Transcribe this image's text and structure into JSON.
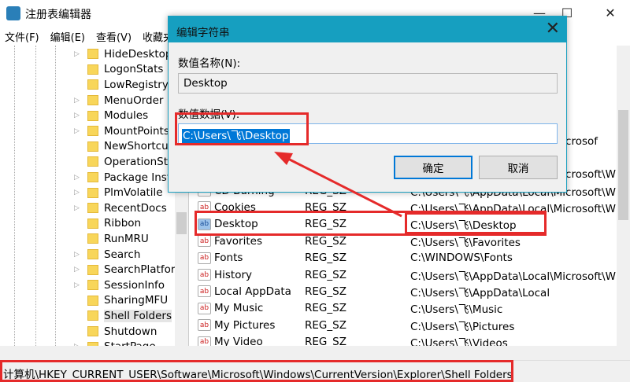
{
  "window": {
    "title": "注册表编辑器",
    "minimize": "—",
    "maximize": "☐",
    "close": "✕"
  },
  "menu": [
    "文件(F)",
    "编辑(E)",
    "查看(V)",
    "收藏夹"
  ],
  "tree": {
    "items": [
      {
        "label": "HideDesktop",
        "expandable": true
      },
      {
        "label": "LogonStats",
        "expandable": false
      },
      {
        "label": "LowRegistry",
        "expandable": false
      },
      {
        "label": "MenuOrder",
        "expandable": true
      },
      {
        "label": "Modules",
        "expandable": true
      },
      {
        "label": "MountPoints",
        "expandable": true
      },
      {
        "label": "NewShortcu",
        "expandable": false
      },
      {
        "label": "OperationSta",
        "expandable": false
      },
      {
        "label": "Package Inst",
        "expandable": true
      },
      {
        "label": "PlmVolatile",
        "expandable": true
      },
      {
        "label": "RecentDocs",
        "expandable": true
      },
      {
        "label": "Ribbon",
        "expandable": false
      },
      {
        "label": "RunMRU",
        "expandable": false
      },
      {
        "label": "Search",
        "expandable": true
      },
      {
        "label": "SearchPlatfor",
        "expandable": true
      },
      {
        "label": "SessionInfo",
        "expandable": true
      },
      {
        "label": "SharingMFU",
        "expandable": false
      },
      {
        "label": "Shell Folders",
        "expandable": false,
        "selected": true
      },
      {
        "label": "Shutdown",
        "expandable": false
      },
      {
        "label": "StartPage",
        "expandable": true
      }
    ]
  },
  "list": {
    "partial_rows": [
      {
        "data": "C:\\Users\\飞\\AppData\\Local\\Microsof"
      },
      {
        "data": "C:\\Users\\飞\\AppData\\Local\\Microsoft\\W"
      }
    ],
    "rows": [
      {
        "name": "CD Burning",
        "type": "REG_SZ",
        "data": "C:\\Users\\飞\\AppData\\Local\\Microsoft\\W"
      },
      {
        "name": "Cookies",
        "type": "REG_SZ",
        "data": "C:\\Users\\飞\\AppData\\Local\\Microsoft\\W"
      },
      {
        "name": "Desktop",
        "type": "REG_SZ",
        "data": "C:\\Users\\飞\\Desktop",
        "selected": true
      },
      {
        "name": "Favorites",
        "type": "REG_SZ",
        "data": "C:\\Users\\飞\\Favorites"
      },
      {
        "name": "Fonts",
        "type": "REG_SZ",
        "data": "C:\\WINDOWS\\Fonts"
      },
      {
        "name": "History",
        "type": "REG_SZ",
        "data": "C:\\Users\\飞\\AppData\\Local\\Microsoft\\W"
      },
      {
        "name": "Local AppData",
        "type": "REG_SZ",
        "data": "C:\\Users\\飞\\AppData\\Local"
      },
      {
        "name": "My Music",
        "type": "REG_SZ",
        "data": "C:\\Users\\飞\\Music"
      },
      {
        "name": "My Pictures",
        "type": "REG_SZ",
        "data": "C:\\Users\\飞\\Pictures"
      },
      {
        "name": "My Video",
        "type": "REG_SZ",
        "data": "C:\\Users\\飞\\Videos"
      }
    ],
    "icon_text": "ab"
  },
  "status": {
    "path": "计算机\\HKEY_CURRENT_USER\\Software\\Microsoft\\Windows\\CurrentVersion\\Explorer\\Shell Folders"
  },
  "dialog": {
    "title": "编辑字符串",
    "close": "✕",
    "name_label": "数值名称(N):",
    "name_value": "Desktop",
    "data_label": "数值数据(V):",
    "data_value": "C:\\Users\\飞\\Desktop",
    "ok": "确定",
    "cancel": "取消"
  },
  "colors": {
    "accent": "#169fc0",
    "highlight": "#e52a2a",
    "selection": "#0078d7"
  }
}
